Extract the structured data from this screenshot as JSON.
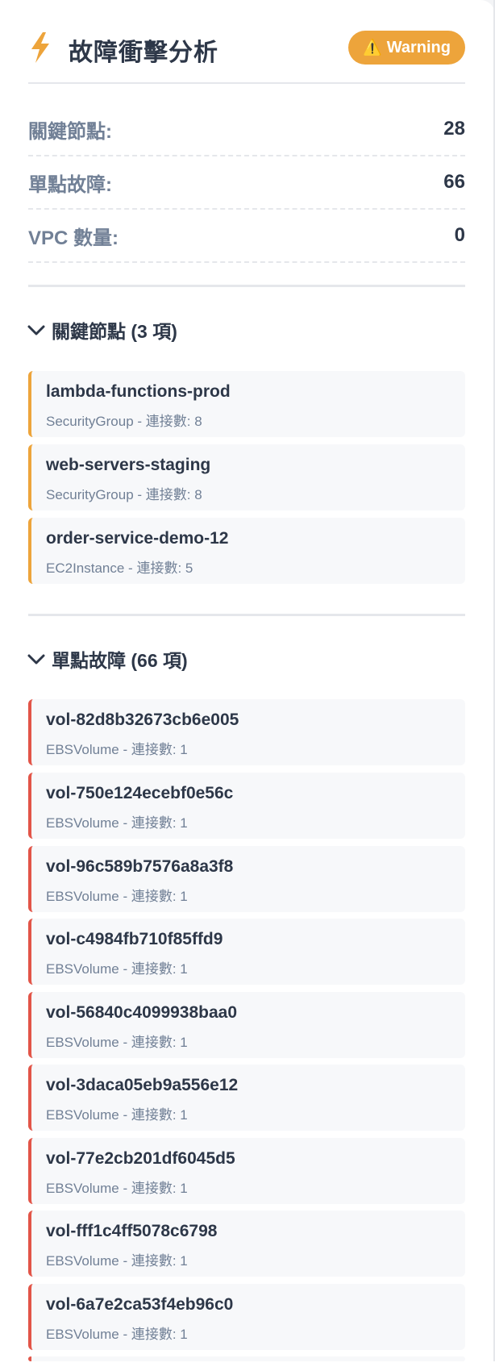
{
  "header": {
    "title": "故障衝擊分析",
    "icon": "lightning-bolt-icon",
    "badge": "Warning",
    "badge_icon": "⚠️",
    "badge_color": "#eda43b"
  },
  "stats": [
    {
      "label": "關鍵節點:",
      "value": "28"
    },
    {
      "label": "單點故障:",
      "value": "66"
    },
    {
      "label": "VPC 數量:",
      "value": "0"
    }
  ],
  "critical_section": {
    "heading": "關鍵節點 (3 項)",
    "accent": "#eda43b",
    "items": [
      {
        "name": "lambda-functions-prod",
        "detail": "SecurityGroup - 連接數: 8"
      },
      {
        "name": "web-servers-staging",
        "detail": "SecurityGroup - 連接數: 8"
      },
      {
        "name": "order-service-demo-12",
        "detail": "EC2Instance - 連接數: 5"
      }
    ]
  },
  "spof_section": {
    "heading": "單點故障 (66 項)",
    "accent": "#e25548",
    "items": [
      {
        "name": "vol-82d8b32673cb6e005",
        "detail": "EBSVolume - 連接數: 1"
      },
      {
        "name": "vol-750e124ecebf0e56c",
        "detail": "EBSVolume - 連接數: 1"
      },
      {
        "name": "vol-96c589b7576a8a3f8",
        "detail": "EBSVolume - 連接數: 1"
      },
      {
        "name": "vol-c4984fb710f85ffd9",
        "detail": "EBSVolume - 連接數: 1"
      },
      {
        "name": "vol-56840c4099938baa0",
        "detail": "EBSVolume - 連接數: 1"
      },
      {
        "name": "vol-3daca05eb9a556e12",
        "detail": "EBSVolume - 連接數: 1"
      },
      {
        "name": "vol-77e2cb201df6045d5",
        "detail": "EBSVolume - 連接數: 1"
      },
      {
        "name": "vol-fff1c4ff5078c6798",
        "detail": "EBSVolume - 連接數: 1"
      },
      {
        "name": "vol-6a7e2ca53f4eb96c0",
        "detail": "EBSVolume - 連接數: 1"
      }
    ]
  }
}
